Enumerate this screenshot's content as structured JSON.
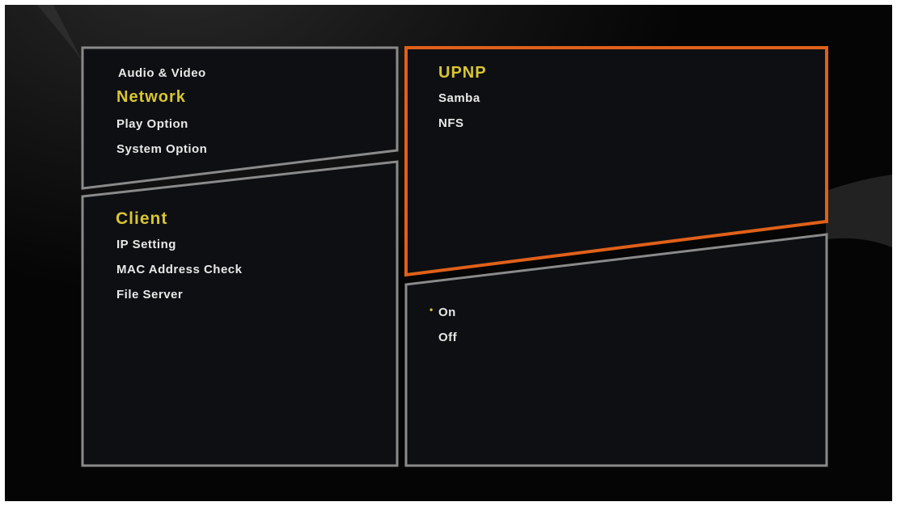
{
  "colors": {
    "highlight": "#d9c631",
    "focus_border": "#e0601a",
    "panel_border": "#8a8a8a",
    "panel_fill": "#0d0f12",
    "text": "#e8e8e8"
  },
  "category_menu": {
    "items": [
      {
        "label": "Audio & Video",
        "selected": false
      },
      {
        "label": "Network",
        "selected": true
      },
      {
        "label": "Play Option",
        "selected": false
      },
      {
        "label": "System Option",
        "selected": false
      }
    ]
  },
  "network_menu": {
    "items": [
      {
        "label": "Client",
        "selected": true
      },
      {
        "label": "IP Setting",
        "selected": false
      },
      {
        "label": "MAC Address Check",
        "selected": false
      },
      {
        "label": "File Server",
        "selected": false
      }
    ]
  },
  "server_menu": {
    "focused": true,
    "items": [
      {
        "label": "UPNP",
        "selected": true
      },
      {
        "label": "Samba",
        "selected": false
      },
      {
        "label": "NFS",
        "selected": false
      }
    ]
  },
  "value_menu": {
    "bullet_icon": "dot-icon",
    "items": [
      {
        "label": "On",
        "checked": true
      },
      {
        "label": "Off",
        "checked": false
      }
    ]
  }
}
